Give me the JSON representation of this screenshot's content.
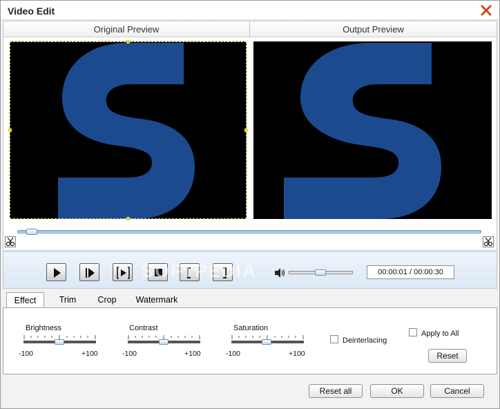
{
  "window": {
    "title": "Video Edit"
  },
  "preview": {
    "original_label": "Original Preview",
    "output_label": "Output Preview",
    "watermark_text": "SOFTPEDIA"
  },
  "controls": {
    "time_display": "00:00:01 / 00:00:30",
    "volume_fraction": 0.45,
    "timeline_fraction": 0.02
  },
  "tabs": [
    {
      "label": "Effect",
      "active": true
    },
    {
      "label": "Trim"
    },
    {
      "label": "Crop"
    },
    {
      "label": "Watermark"
    }
  ],
  "effect": {
    "sliders": [
      {
        "label": "Brightness",
        "min_label": "-100",
        "max_label": "+100",
        "value": 0
      },
      {
        "label": "Contrast",
        "min_label": "-100",
        "max_label": "+100",
        "value": 0
      },
      {
        "label": "Saturation",
        "min_label": "-100",
        "max_label": "+100",
        "value": 0
      }
    ],
    "deinterlacing_label": "Deinterlacing",
    "apply_all_label": "Apply to All",
    "reset_label": "Reset"
  },
  "footer": {
    "reset_all_label": "Reset all",
    "ok_label": "OK",
    "cancel_label": "Cancel"
  },
  "colors": {
    "logo_blue": "#1b4a8f",
    "crop_frame": "#e6d23a"
  }
}
